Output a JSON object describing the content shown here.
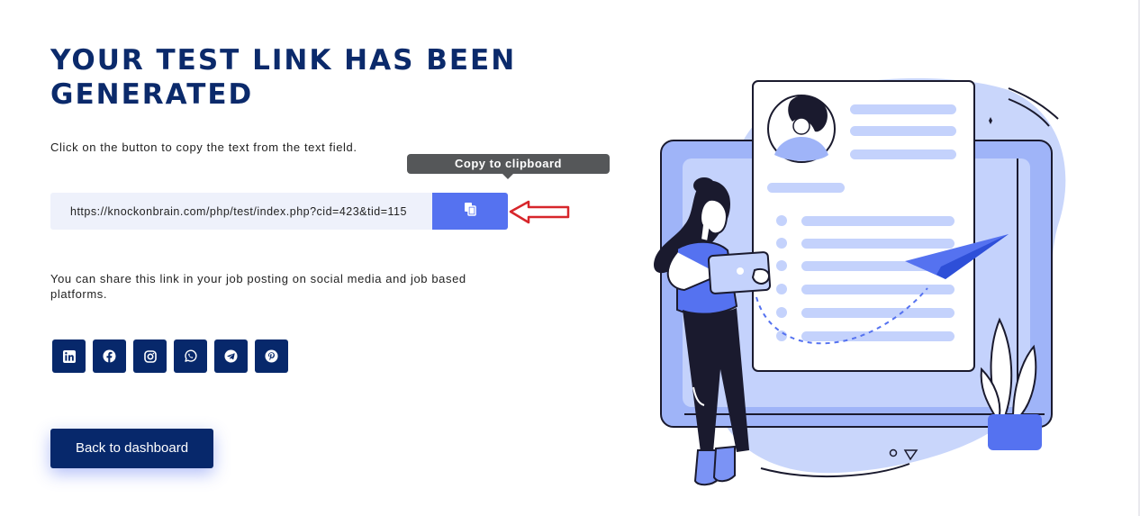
{
  "page": {
    "title": "YOUR TEST LINK HAS BEEN GENERATED",
    "instruction": "Click on the button to copy the text from the text field.",
    "link_field": {
      "value": "https://knockonbrain.com/php/test/index.php?cid=423&tid=115"
    },
    "copy_button": {
      "icon": "copy-icon",
      "tooltip": "Copy to clipboard"
    },
    "share_text": "You can share this link in your job posting on social media and job based platforms.",
    "social_buttons": [
      {
        "name": "linkedin",
        "icon": "linkedin-icon"
      },
      {
        "name": "facebook",
        "icon": "facebook-icon"
      },
      {
        "name": "instagram",
        "icon": "instagram-icon"
      },
      {
        "name": "whatsapp",
        "icon": "whatsapp-icon"
      },
      {
        "name": "telegram",
        "icon": "telegram-icon"
      },
      {
        "name": "pinterest",
        "icon": "pinterest-icon"
      }
    ],
    "back_button": "Back to dashboard"
  },
  "colors": {
    "title": "#0b2a6b",
    "primary_dark": "#07286b",
    "accent_blue": "#5572f0",
    "tooltip_bg": "#555759",
    "arrow_red": "#d7262b",
    "field_bg": "#eef1fb"
  }
}
